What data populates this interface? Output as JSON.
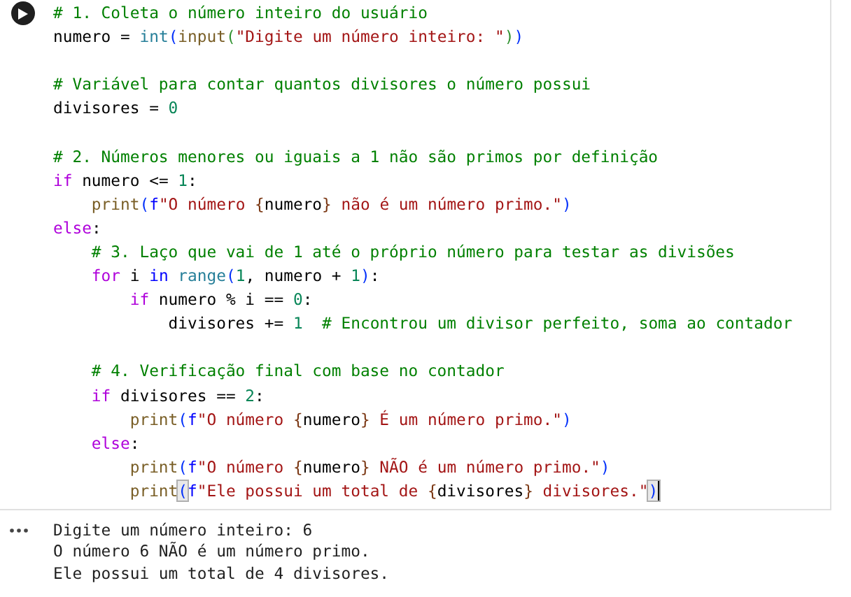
{
  "code_cell": {
    "run_button": {
      "running": false
    },
    "blocks": [
      {
        "lines": [
          {
            "tokens": [
              {
                "kind": "comment",
                "text": "# 1. Coleta o número inteiro do usuário"
              }
            ]
          },
          {
            "tokens": [
              {
                "kind": "plain",
                "text": "numero = "
              },
              {
                "kind": "builtin",
                "text": "int"
              },
              {
                "kind": "paren",
                "text": "("
              },
              {
                "kind": "func",
                "text": "input"
              },
              {
                "kind": "paren2",
                "text": "("
              },
              {
                "kind": "string",
                "text": "\"Digite um número inteiro: \""
              },
              {
                "kind": "paren2",
                "text": ")"
              },
              {
                "kind": "paren",
                "text": ")"
              }
            ]
          }
        ]
      },
      {
        "lines": [
          {
            "tokens": [
              {
                "kind": "comment",
                "text": "# Variável para contar quantos divisores o número possui"
              }
            ]
          },
          {
            "tokens": [
              {
                "kind": "plain",
                "text": "divisores = "
              },
              {
                "kind": "number",
                "text": "0"
              }
            ]
          }
        ]
      },
      {
        "lines": [
          {
            "tokens": [
              {
                "kind": "comment",
                "text": "# 2. Números menores ou iguais a 1 não são primos por definição"
              }
            ]
          },
          {
            "tokens": [
              {
                "kind": "keyword",
                "text": "if"
              },
              {
                "kind": "plain",
                "text": " numero <= "
              },
              {
                "kind": "number",
                "text": "1"
              },
              {
                "kind": "plain",
                "text": ":"
              }
            ]
          },
          {
            "tokens": [
              {
                "kind": "func",
                "text": "    print"
              },
              {
                "kind": "paren",
                "text": "("
              },
              {
                "kind": "fprefix",
                "text": "f"
              },
              {
                "kind": "string",
                "text": "\"O número "
              },
              {
                "kind": "brace",
                "text": "{"
              },
              {
                "kind": "plain",
                "text": "numero"
              },
              {
                "kind": "brace",
                "text": "}"
              },
              {
                "kind": "string",
                "text": " não é um número primo.\""
              },
              {
                "kind": "paren",
                "text": ")"
              }
            ]
          },
          {
            "tokens": [
              {
                "kind": "keyword",
                "text": "else"
              },
              {
                "kind": "plain",
                "text": ":"
              }
            ]
          },
          {
            "tokens": [
              {
                "kind": "comment",
                "text": "    # 3. Laço que vai de 1 até o próprio número para testar as divisões"
              }
            ]
          },
          {
            "tokens": [
              {
                "kind": "keyword",
                "text": "    for"
              },
              {
                "kind": "plain",
                "text": " i "
              },
              {
                "kind": "operator",
                "text": "in "
              },
              {
                "kind": "builtin",
                "text": "range"
              },
              {
                "kind": "paren",
                "text": "("
              },
              {
                "kind": "number",
                "text": "1"
              },
              {
                "kind": "plain",
                "text": ", numero + "
              },
              {
                "kind": "number",
                "text": "1"
              },
              {
                "kind": "paren",
                "text": ")"
              },
              {
                "kind": "plain",
                "text": ":"
              }
            ]
          },
          {
            "tokens": [
              {
                "kind": "keyword",
                "text": "        if"
              },
              {
                "kind": "plain",
                "text": " numero % i == "
              },
              {
                "kind": "number",
                "text": "0"
              },
              {
                "kind": "plain",
                "text": ":"
              }
            ]
          },
          {
            "tokens": [
              {
                "kind": "plain",
                "text": "            divisores += "
              },
              {
                "kind": "number",
                "text": "1  "
              },
              {
                "kind": "comment",
                "text": "# Encontrou um divisor perfeito, soma ao contador"
              }
            ]
          }
        ]
      },
      {
        "lines": [
          {
            "tokens": [
              {
                "kind": "comment",
                "text": "    # 4. Verificação final com base no contador"
              }
            ]
          },
          {
            "tokens": [
              {
                "kind": "keyword",
                "text": "    if"
              },
              {
                "kind": "plain",
                "text": " divisores == "
              },
              {
                "kind": "number",
                "text": "2"
              },
              {
                "kind": "plain",
                "text": ":"
              }
            ]
          },
          {
            "tokens": [
              {
                "kind": "func",
                "text": "        print"
              },
              {
                "kind": "paren",
                "text": "("
              },
              {
                "kind": "fprefix",
                "text": "f"
              },
              {
                "kind": "string",
                "text": "\"O número "
              },
              {
                "kind": "brace",
                "text": "{"
              },
              {
                "kind": "plain",
                "text": "numero"
              },
              {
                "kind": "brace",
                "text": "}"
              },
              {
                "kind": "string",
                "text": " É um número primo.\""
              },
              {
                "kind": "paren",
                "text": ")"
              }
            ]
          },
          {
            "tokens": [
              {
                "kind": "keyword",
                "text": "    else"
              },
              {
                "kind": "plain",
                "text": ":"
              }
            ]
          },
          {
            "tokens": [
              {
                "kind": "func",
                "text": "        print"
              },
              {
                "kind": "paren",
                "text": "("
              },
              {
                "kind": "fprefix",
                "text": "f"
              },
              {
                "kind": "string",
                "text": "\"O número "
              },
              {
                "kind": "brace",
                "text": "{"
              },
              {
                "kind": "plain",
                "text": "numero"
              },
              {
                "kind": "brace",
                "text": "}"
              },
              {
                "kind": "string",
                "text": " NÃO é um número primo.\""
              },
              {
                "kind": "paren",
                "text": ")"
              }
            ]
          },
          {
            "tokens": [
              {
                "kind": "func",
                "text": "        print"
              },
              {
                "kind": "paren",
                "text": "(",
                "bracket_match": true
              },
              {
                "kind": "fprefix",
                "text": "f"
              },
              {
                "kind": "string",
                "text": "\"Ele possui um total de "
              },
              {
                "kind": "brace",
                "text": "{"
              },
              {
                "kind": "plain",
                "text": "divisores"
              },
              {
                "kind": "brace",
                "text": "}"
              },
              {
                "kind": "string",
                "text": " divisores.\""
              },
              {
                "kind": "paren",
                "text": ")",
                "bracket_match": true,
                "cursor": true
              }
            ]
          }
        ]
      }
    ]
  },
  "output": {
    "lines": [
      "Digite um número inteiro: 6",
      "O número 6 NÃO é um número primo.",
      "Ele possui um total de 4 divisores."
    ]
  }
}
